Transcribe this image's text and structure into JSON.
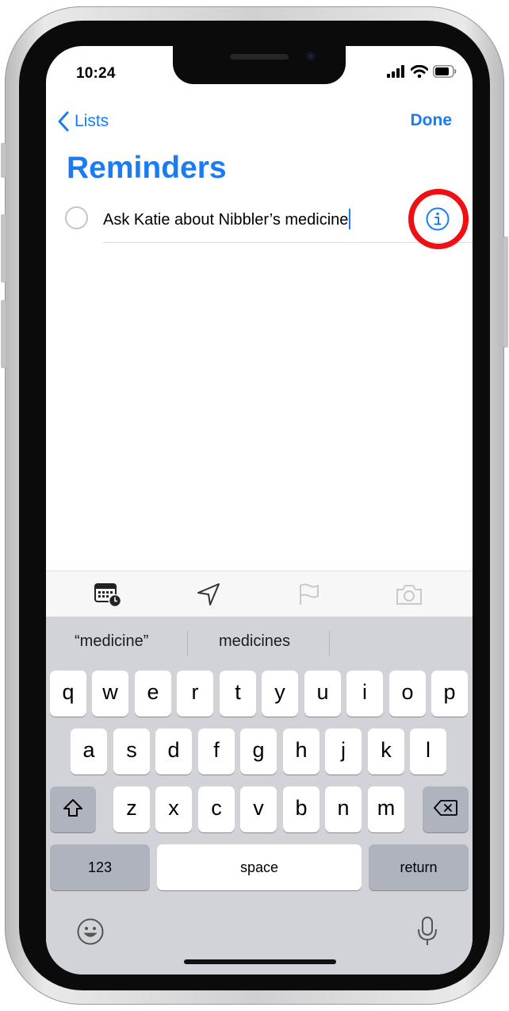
{
  "status_bar": {
    "time": "10:24"
  },
  "nav": {
    "back_label": "Lists",
    "done_label": "Done"
  },
  "page": {
    "title": "Reminders"
  },
  "reminder": {
    "text": "Ask Katie about Nibbler’s medicine"
  },
  "toolbar": {
    "icons": [
      "calendar-clock-icon",
      "location-arrow-icon",
      "flag-icon",
      "camera-icon"
    ]
  },
  "keyboard": {
    "suggestions": [
      "“medicine”",
      "medicines"
    ],
    "row1": [
      "q",
      "w",
      "e",
      "r",
      "t",
      "y",
      "u",
      "i",
      "o",
      "p"
    ],
    "row2": [
      "a",
      "s",
      "d",
      "f",
      "g",
      "h",
      "j",
      "k",
      "l"
    ],
    "row3": [
      "z",
      "x",
      "c",
      "v",
      "b",
      "n",
      "m"
    ],
    "numbers_label": "123",
    "space_label": "space",
    "return_label": "return"
  },
  "colors": {
    "accent": "#1a7cf5",
    "highlight_ring": "#f00f14",
    "keyboard_bg": "#d1d3d9"
  }
}
